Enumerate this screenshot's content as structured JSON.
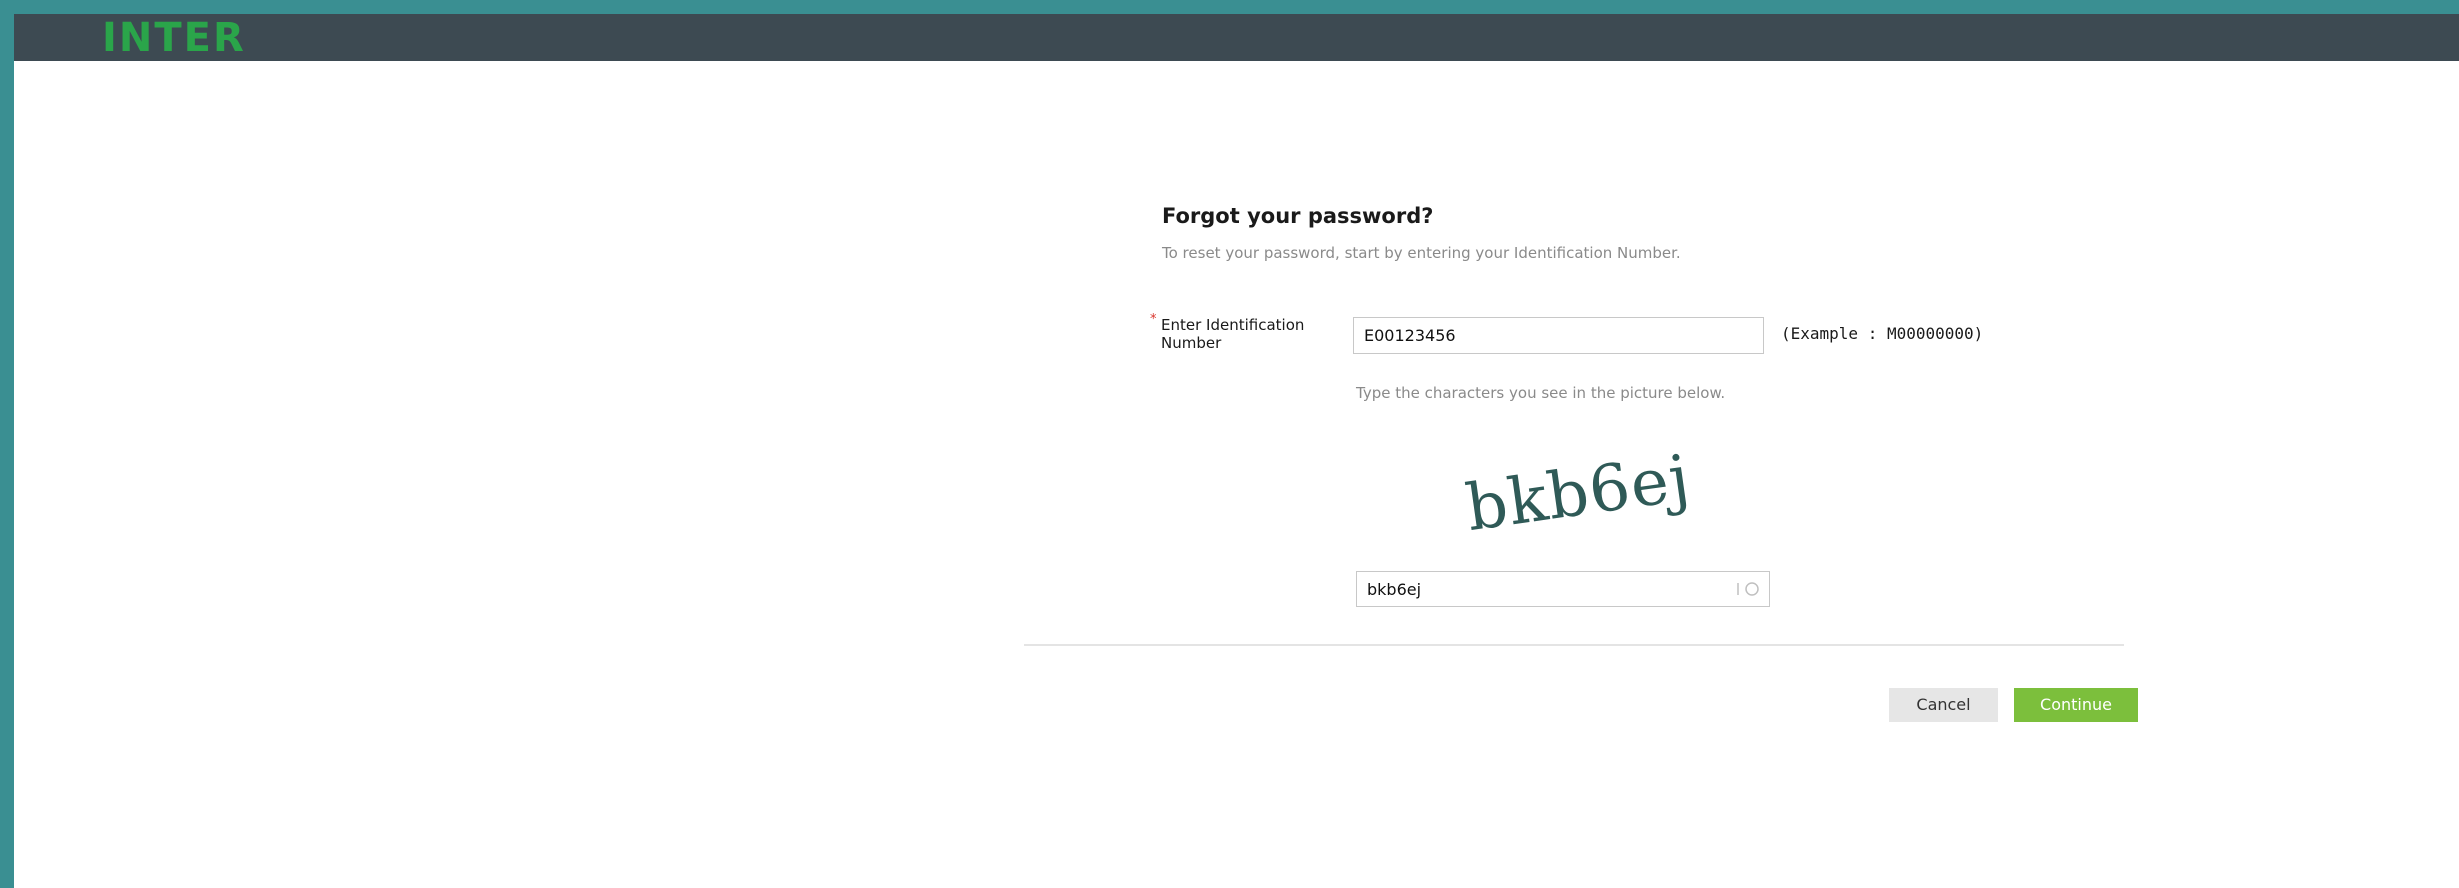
{
  "header": {
    "logo_text": "INTER"
  },
  "form": {
    "title": "Forgot your password?",
    "subtitle": "To reset your password, start by entering your Identification Number.",
    "required_marker": "*",
    "id_label": "Enter Identification Number",
    "id_value": "E00123456",
    "id_example": "(Example : M00000000)",
    "captcha_hint": "Type the characters you see in the picture below.",
    "captcha_image_text": "bkb6ej",
    "captcha_value": "bkb6ej"
  },
  "buttons": {
    "cancel_label": "Cancel",
    "continue_label": "Continue"
  },
  "colors": {
    "frame": "#3a8f92",
    "topbar": "#3d4a52",
    "logo": "#2aa54a",
    "continue": "#7cbf3c",
    "cancel": "#e6e6e6",
    "captcha_ink": "#2f5a57"
  }
}
